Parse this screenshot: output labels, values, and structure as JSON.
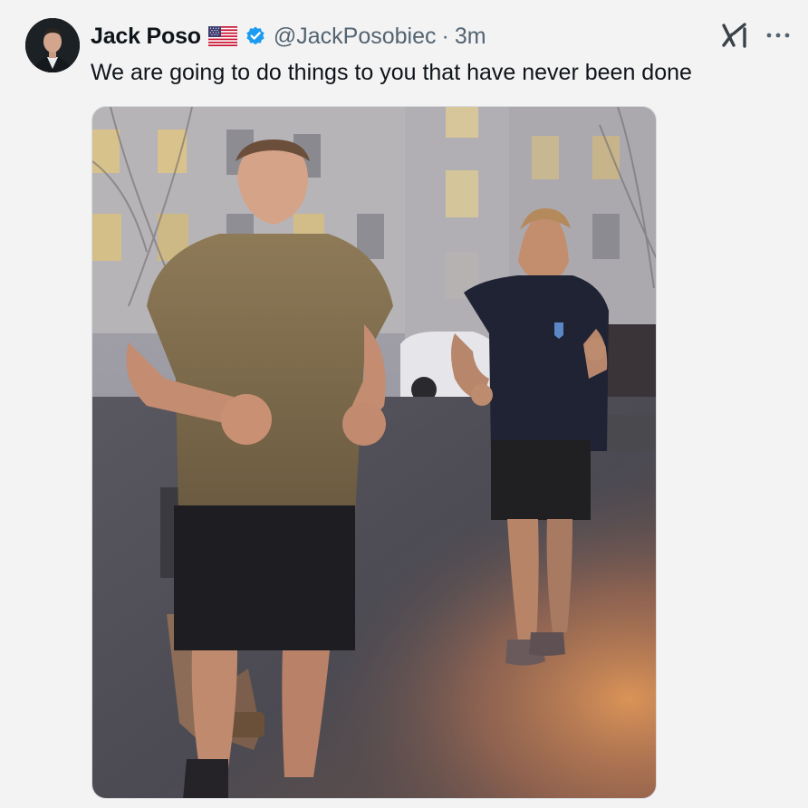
{
  "author": {
    "display_name": "Jack Poso",
    "handle": "@JackPosobiec",
    "separator": "·",
    "time": "3m",
    "flag_icon": "us-flag-icon",
    "verified_icon": "verified-badge-icon"
  },
  "tweet": {
    "text": "We are going to do things to you that have never been done"
  },
  "actions": {
    "grok_icon": "grok-icon",
    "more_icon": "more-icon"
  },
  "colors": {
    "background": "#f3f3f4",
    "text_primary": "#0f1419",
    "text_secondary": "#536471",
    "verified_blue": "#1d9bf0"
  }
}
